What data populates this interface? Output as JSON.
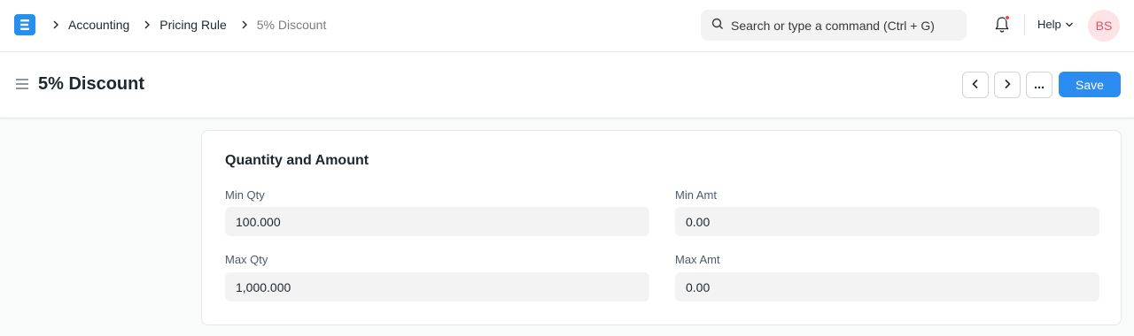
{
  "breadcrumb": {
    "items": [
      "Accounting",
      "Pricing Rule",
      "5% Discount"
    ]
  },
  "search": {
    "placeholder": "Search or type a command (Ctrl + G)"
  },
  "navbar": {
    "help_label": "Help",
    "avatar_initials": "BS",
    "notification_dot_color": "#e24c4c"
  },
  "page": {
    "title": "5% Discount",
    "save_label": "Save"
  },
  "section": {
    "title": "Quantity and Amount",
    "fields": [
      {
        "label": "Min Qty",
        "value": "100.000"
      },
      {
        "label": "Min Amt",
        "value": "0.00"
      },
      {
        "label": "Max Qty",
        "value": "1,000.000"
      },
      {
        "label": "Max Amt",
        "value": "0.00"
      }
    ]
  },
  "colors": {
    "accent": "#2490ef",
    "save_button": "#2d8cf0"
  },
  "icons": [
    "app-logo-icon",
    "chevron-right-icon",
    "search-icon",
    "bell-icon",
    "chevron-down-icon",
    "hamburger-icon",
    "chevron-left-icon",
    "ellipsis-icon"
  ]
}
